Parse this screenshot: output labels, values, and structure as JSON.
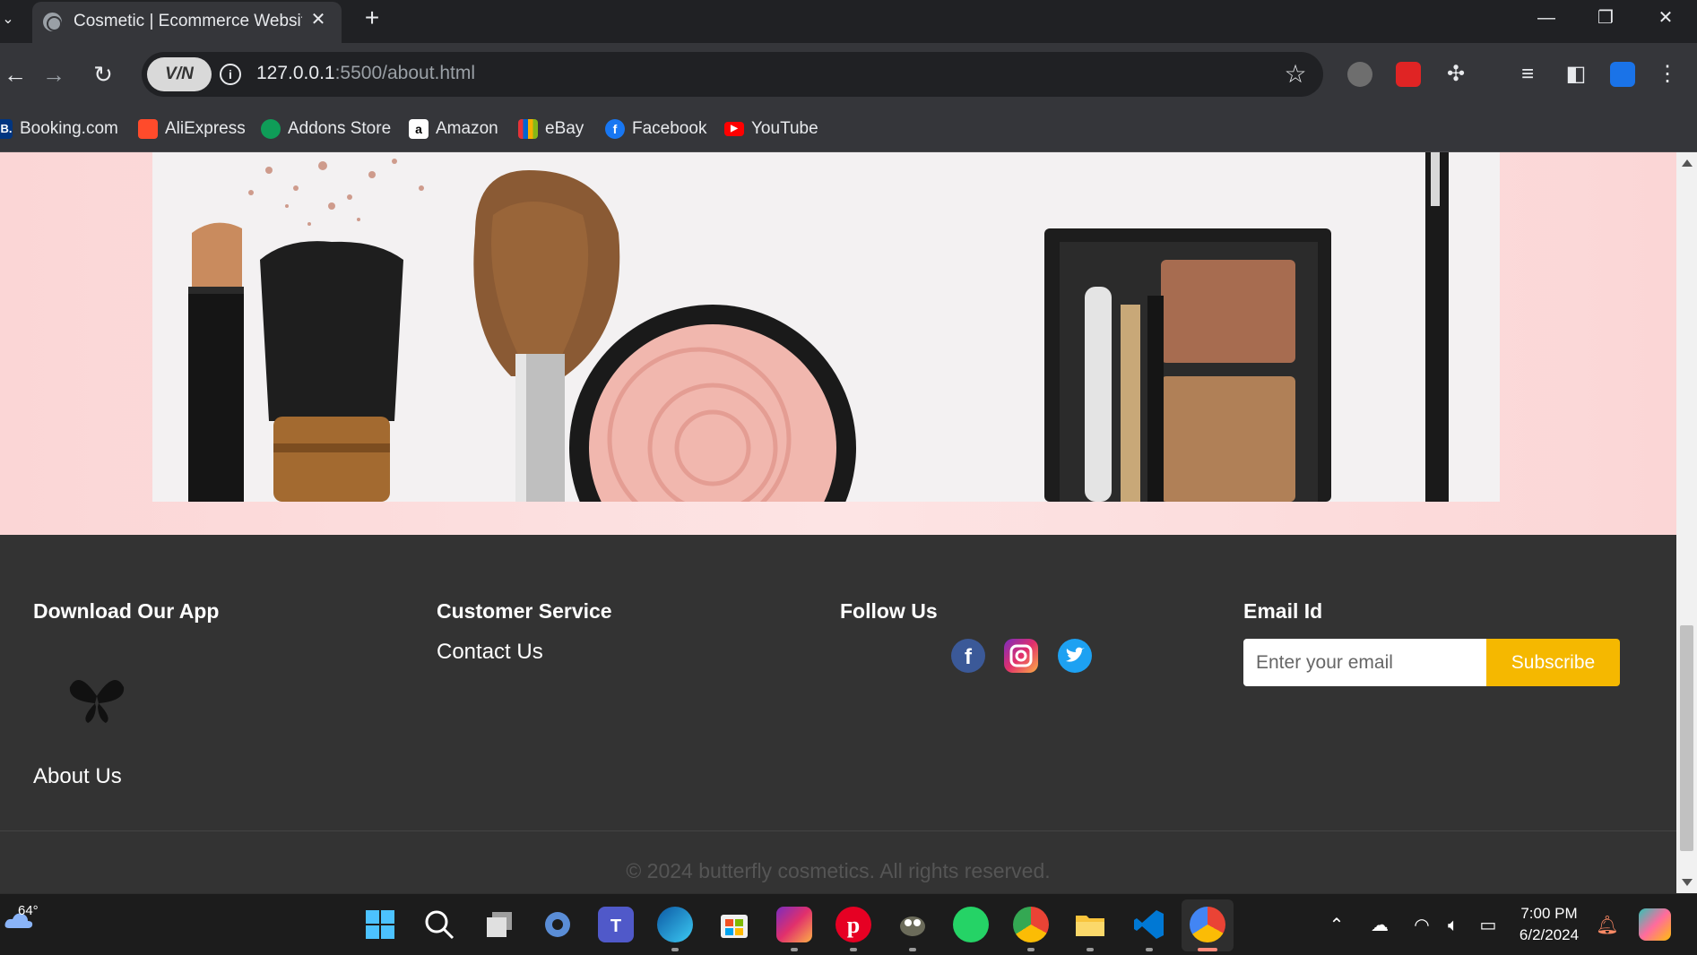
{
  "browser": {
    "tab_title": "Cosmetic | Ecommerce Website",
    "url_host": "127.0.0.1",
    "url_rest": ":5500/about.html",
    "vpn_label": "V/N"
  },
  "bookmarks": [
    {
      "label": "Booking.com",
      "icon": "booking-icon",
      "color": "#003580",
      "glyph": "B."
    },
    {
      "label": "AliExpress",
      "icon": "aliexpress-icon",
      "color": "#ff4b2b",
      "glyph": ""
    },
    {
      "label": "Addons Store",
      "icon": "addons-store-icon",
      "color": "#0f9d58",
      "glyph": ""
    },
    {
      "label": "Amazon",
      "icon": "amazon-icon",
      "color": "#ffffff",
      "glyph": "a"
    },
    {
      "label": "eBay",
      "icon": "ebay-icon",
      "color": "#e53238",
      "glyph": ""
    },
    {
      "label": "Facebook",
      "icon": "facebook-icon",
      "color": "#1877f2",
      "glyph": "f"
    },
    {
      "label": "YouTube",
      "icon": "youtube-icon",
      "color": "#ff0000",
      "glyph": "▶"
    }
  ],
  "footer": {
    "download_heading": "Download Our App",
    "logo_text": "BUTTERFLY",
    "about_link": "About Us",
    "service_heading": "Customer Service",
    "contact_link": "Contact Us",
    "follow_heading": "Follow Us",
    "email_heading": "Email Id",
    "email_placeholder": "Enter your email",
    "subscribe_label": "Subscribe",
    "copyright": "© 2024 butterfly cosmetics. All rights reserved."
  },
  "taskbar": {
    "weather": "64°",
    "time": "7:00 PM",
    "date": "6/2/2024"
  },
  "colors": {
    "accent": "#f5b800",
    "footer_bg": "#333333",
    "hero_bg": "#fbd6d6"
  }
}
